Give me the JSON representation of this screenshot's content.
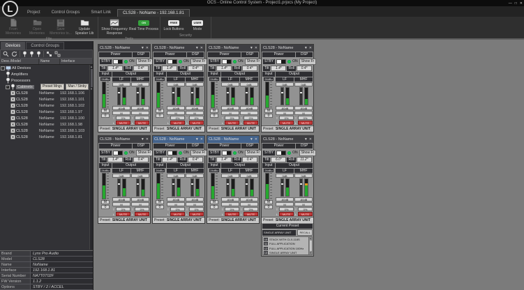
{
  "window": {
    "title": "OCS - Online Control System - Project1.prjocs (My Project)",
    "logo_letter": "L",
    "buttons": [
      {
        "name": "minimize",
        "glyph": "—"
      },
      {
        "name": "maximize",
        "glyph": "□"
      },
      {
        "name": "close",
        "glyph": "✕"
      }
    ]
  },
  "ribbon": {
    "tabs": [
      {
        "label": "Project",
        "active": false
      },
      {
        "label": "Control Groups",
        "active": false
      },
      {
        "label": "Smart Link",
        "active": false
      },
      {
        "label": "CLS28 - NoName - 192.168.1.81",
        "active": true
      }
    ],
    "groups": [
      {
        "caption": "File",
        "buttons": [
          {
            "label": "From Memories",
            "icon": "document-icon",
            "disabled": true
          },
          {
            "label": "Open Memories",
            "icon": "folder-open-icon",
            "disabled": true
          },
          {
            "label": "Save Memories to...",
            "icon": "save-icon",
            "disabled": true
          },
          {
            "label": "Update Speaker Lib",
            "icon": "folder-icon",
            "disabled": false
          }
        ]
      },
      {
        "caption": "Tools",
        "buttons": [
          {
            "label": "Show Frequency Response",
            "icon": "frequency-window-icon",
            "disabled": false,
            "wide": true
          },
          {
            "label": "Real Time Process",
            "icon": "badge-icon",
            "badge": "ON",
            "badge_color": "#35a23c",
            "badge_text_color": "#eaffea",
            "disabled": false,
            "wide": true
          }
        ]
      },
      {
        "caption": "Security",
        "buttons": [
          {
            "label": "Lock Buttons",
            "icon": "badge-icon",
            "badge": "FREE",
            "badge_color": "#e8e8e8",
            "badge_text_color": "#111111",
            "disabled": false
          },
          {
            "label": "Mode",
            "icon": "badge-icon",
            "badge": "USER",
            "badge_color": "#e8e8e8",
            "badge_text_color": "#111111",
            "disabled": false
          }
        ]
      }
    ]
  },
  "sidebar": {
    "tabs": [
      {
        "label": "Devices",
        "active": true
      },
      {
        "label": "Control Groups",
        "active": false
      }
    ],
    "toolbar_icons": [
      "search-icon",
      "refresh-icon",
      "pin-icon",
      "pin-icon",
      "pin-icon",
      "group-icon",
      "ungroup-icon"
    ],
    "columns": [
      "Desc./Model",
      "Name",
      "Interface"
    ],
    "tree": [
      {
        "label": "All Devices",
        "level": 0,
        "icon": "computer-icon",
        "expander": true
      },
      {
        "label": "Amplifiers",
        "level": 1,
        "icon": "pin-icon"
      },
      {
        "label": "Processors",
        "level": 1,
        "icon": "pin-icon"
      },
      {
        "label": "Cabinets",
        "level": 1,
        "icon": "pin-icon",
        "expander": true,
        "selected": true,
        "buttons": [
          "Preset Mngr.",
          "Man / Stnby"
        ]
      },
      {
        "label": "CLS28",
        "name": "NoName",
        "interface": "192.168.1.106",
        "level": 2,
        "icon": "device-icon"
      },
      {
        "label": "CLS28",
        "name": "NoName",
        "interface": "192.168.1.101",
        "level": 2,
        "icon": "device-icon"
      },
      {
        "label": "CLS28",
        "name": "NoName",
        "interface": "192.168.1.102",
        "level": 2,
        "icon": "device-icon"
      },
      {
        "label": "CLS28",
        "name": "NoName",
        "interface": "192.168.1.97",
        "level": 2,
        "icon": "device-icon"
      },
      {
        "label": "CLS28",
        "name": "NoName",
        "interface": "192.168.1.100",
        "level": 2,
        "icon": "device-icon"
      },
      {
        "label": "CLS28",
        "name": "NoName",
        "interface": "192.168.1.98",
        "level": 2,
        "icon": "device-icon"
      },
      {
        "label": "CLS28",
        "name": "NoName",
        "interface": "192.168.1.103",
        "level": 2,
        "icon": "device-icon"
      },
      {
        "label": "CLS28",
        "name": "NoName",
        "interface": "192.168.1.81",
        "level": 2,
        "icon": "device-icon"
      }
    ],
    "properties": [
      {
        "label": "Brand",
        "value": "Lynx Pro Audio"
      },
      {
        "label": "Model",
        "value": "CLS28"
      },
      {
        "label": "Name",
        "value": "NoName"
      },
      {
        "label": "Interface",
        "value": "192.168.1.81"
      },
      {
        "label": "Serial Number",
        "value": "NA7T0T02F"
      },
      {
        "label": "FW Version",
        "value": "1.1.2"
      },
      {
        "label": "Options",
        "value": "STBY / 2 / ACCEL"
      }
    ]
  },
  "panel_common": {
    "power_label": "Power",
    "dsp_label": "DSP",
    "stby_label": "STBY",
    "on_label": "ON",
    "show_fr_label": "Show Fr",
    "tilt_label": "Tilt",
    "roll_label": "Roll",
    "input_label": "Input",
    "output_label": "Output",
    "input_value": "24dBu",
    "input_gain": "0",
    "mute_label": "M",
    "temp_label": "T",
    "temp_value": "0%",
    "lim_label": "L",
    "mute_button_label": "MUTE",
    "out_channels": [
      "LF",
      "MHF"
    ],
    "out_value": "0dB",
    "fader_value": "-60dB",
    "preset_label": "Preset:"
  },
  "panels": [
    {
      "title": "CLS28 - NoName",
      "selected": false,
      "tilt": "1.4°",
      "roll": "0.4°",
      "preset": "SINGLE ARRAY UNIT",
      "input_level": 52,
      "out_levels": [
        40,
        34
      ],
      "warn": false,
      "has_preset_list": false
    },
    {
      "title": "CLS28 - NoName",
      "selected": false,
      "tilt": "1.4°",
      "roll": "0.4°",
      "preset": "SINGLE ARRAY UNIT",
      "input_level": 58,
      "out_levels": [
        46,
        38
      ],
      "warn": false,
      "has_preset_list": false
    },
    {
      "title": "CLS28 - NoName",
      "selected": false,
      "tilt": "1.4°",
      "roll": "0.4°",
      "preset": "SINGLE ARRAY UNIT",
      "input_level": 50,
      "out_levels": [
        42,
        40
      ],
      "warn": false,
      "has_preset_list": false
    },
    {
      "title": "CLS28 - NoName",
      "selected": false,
      "tilt": "1.4°",
      "roll": "0.4°",
      "preset": "SINGLE ARRAY UNIT",
      "input_level": 48,
      "out_levels": [
        38,
        32
      ],
      "warn": false,
      "has_preset_list": false
    },
    {
      "title": "CLS28 - NoName",
      "selected": false,
      "tilt": "1.4°",
      "roll": "0.4°",
      "preset": "SINGLE ARRAY UNIT",
      "input_level": 54,
      "out_levels": [
        44,
        36
      ],
      "warn": false,
      "has_preset_list": false
    },
    {
      "title": "CLS28 - NoName",
      "selected": true,
      "tilt": "1.4°",
      "roll": "0.4°",
      "preset": "SINGLE ARRAY UNIT",
      "input_level": 60,
      "out_levels": [
        48,
        42
      ],
      "warn": false,
      "has_preset_list": false
    },
    {
      "title": "CLS28 - NoName",
      "selected": true,
      "tilt": "1.4°",
      "roll": "0.4°",
      "preset": "SINGLE ARRAY UNIT",
      "input_level": 50,
      "out_levels": [
        42,
        36
      ],
      "warn": false,
      "has_preset_list": false
    },
    {
      "title": "CLS28 - NoName",
      "selected": false,
      "tilt": "6.0°",
      "roll": "11.2°",
      "preset": "SINGLE ARRAY UNIT",
      "input_level": 58,
      "out_levels": [
        52,
        62
      ],
      "warn": true,
      "has_preset_list": true
    }
  ],
  "preset_panel": {
    "header": "Current Preset",
    "current": "SINGLE ARRAY UNIT",
    "recall_label": "RECALL",
    "items": [
      {
        "num": "10",
        "label": "STACK WITH CLX-118S"
      },
      {
        "num": "11",
        "label": "FULL APPLICATION"
      },
      {
        "num": "12",
        "label": "FULL APPLICATION 100Hz"
      },
      {
        "num": "13",
        "label": "SINGLE ARRAY UNIT"
      }
    ]
  },
  "glyphs": {
    "pin": "▼",
    "close": "✕",
    "expand": "−",
    "up": "▲",
    "down": "▼"
  }
}
